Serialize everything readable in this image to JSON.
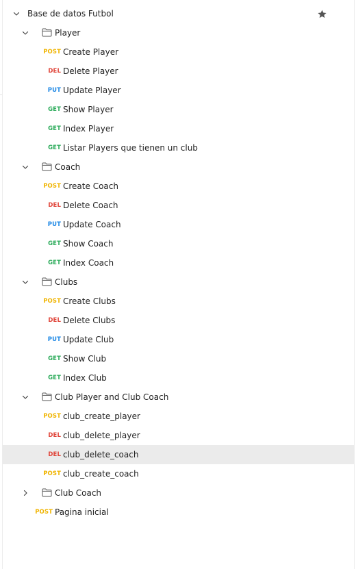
{
  "collection": {
    "name": "Base de datos Futbol",
    "starred": true
  },
  "colors": {
    "post": "#f0b400",
    "del": "#e0453a",
    "put": "#1e88e5",
    "get": "#2eac5c",
    "selected_bg": "#ebebeb"
  },
  "tree": [
    {
      "type": "folder",
      "name": "Player",
      "expanded": true,
      "depth": 1
    },
    {
      "type": "request",
      "method": "POST",
      "name": "Create Player",
      "depth": 2
    },
    {
      "type": "request",
      "method": "DEL",
      "name": "Delete Player",
      "depth": 2
    },
    {
      "type": "request",
      "method": "PUT",
      "name": "Update Player",
      "depth": 2
    },
    {
      "type": "request",
      "method": "GET",
      "name": "Show Player",
      "depth": 2
    },
    {
      "type": "request",
      "method": "GET",
      "name": "Index Player",
      "depth": 2
    },
    {
      "type": "request",
      "method": "GET",
      "name": "Listar Players que tienen un club",
      "depth": 2
    },
    {
      "type": "folder",
      "name": "Coach",
      "expanded": true,
      "depth": 1
    },
    {
      "type": "request",
      "method": "POST",
      "name": "Create Coach",
      "depth": 2
    },
    {
      "type": "request",
      "method": "DEL",
      "name": "Delete Coach",
      "depth": 2
    },
    {
      "type": "request",
      "method": "PUT",
      "name": "Update Coach",
      "depth": 2
    },
    {
      "type": "request",
      "method": "GET",
      "name": "Show Coach",
      "depth": 2
    },
    {
      "type": "request",
      "method": "GET",
      "name": "Index Coach",
      "depth": 2
    },
    {
      "type": "folder",
      "name": "Clubs",
      "expanded": true,
      "depth": 1
    },
    {
      "type": "request",
      "method": "POST",
      "name": "Create Clubs",
      "depth": 2
    },
    {
      "type": "request",
      "method": "DEL",
      "name": "Delete Clubs",
      "depth": 2
    },
    {
      "type": "request",
      "method": "PUT",
      "name": "Update Club",
      "depth": 2
    },
    {
      "type": "request",
      "method": "GET",
      "name": "Show Club",
      "depth": 2
    },
    {
      "type": "request",
      "method": "GET",
      "name": "Index Club",
      "depth": 2
    },
    {
      "type": "folder",
      "name": "Club Player and Club Coach",
      "expanded": true,
      "depth": 1
    },
    {
      "type": "request",
      "method": "POST",
      "name": "club_create_player",
      "depth": 2
    },
    {
      "type": "request",
      "method": "DEL",
      "name": "club_delete_player",
      "depth": 2
    },
    {
      "type": "request",
      "method": "DEL",
      "name": "club_delete_coach",
      "depth": 2,
      "selected": true
    },
    {
      "type": "request",
      "method": "POST",
      "name": "club_create_coach",
      "depth": 2
    },
    {
      "type": "folder",
      "name": "Club Coach",
      "expanded": false,
      "depth": 1
    },
    {
      "type": "request",
      "method": "POST",
      "name": "Pagina inicial",
      "depth": 1
    }
  ]
}
